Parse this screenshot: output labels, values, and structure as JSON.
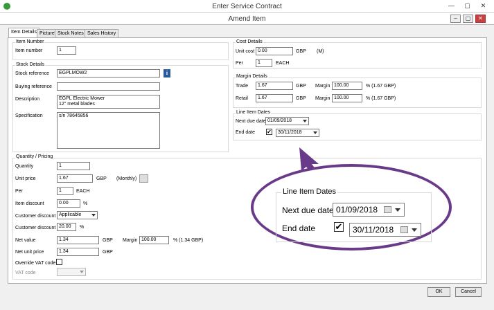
{
  "window": {
    "title": "Enter Service Contract",
    "min": "—",
    "max": "▢",
    "close": "✕"
  },
  "dialog": {
    "title": "Amend Item",
    "min": "–",
    "max": "▢",
    "close": "✕"
  },
  "tabs": [
    {
      "label": "Item Details"
    },
    {
      "label": "Picture"
    },
    {
      "label": "Stock Notes"
    },
    {
      "label": "Sales History"
    }
  ],
  "item_number": {
    "group_title": "Item Number",
    "label": "Item number",
    "value": "1"
  },
  "stock_details": {
    "group_title": "Stock Details",
    "stock_reference_label": "Stock reference",
    "stock_reference_value": "EGPLMOW2",
    "buying_reference_label": "Buying reference",
    "buying_reference_value": "",
    "description_label": "Description",
    "description_line1": "EGPL Electric Mower",
    "description_line2": "12\" metal blades",
    "specification_label": "Specification",
    "specification_value": "s/n 78645856"
  },
  "cost_details": {
    "group_title": "Cost Details",
    "unit_cost_label": "Unit cost",
    "unit_cost_value": "0.00",
    "currency": "GBP",
    "m_tag": "(M)",
    "per_label": "Per",
    "per_value": "1",
    "per_unit": "EACH"
  },
  "margin_details": {
    "group_title": "Margin Details",
    "trade_label": "Trade",
    "trade_value": "1.67",
    "retail_label": "Retail",
    "retail_value": "1.67",
    "currency": "GBP",
    "margin_label": "Margin",
    "trade_margin_value": "100.00",
    "trade_margin_note": "% (1.67 GBP)",
    "retail_margin_value": "100.00",
    "retail_margin_note": "% (1.67 GBP)"
  },
  "line_item_dates": {
    "group_title": "Line Item Dates",
    "next_due_label": "Next due date",
    "next_due_value": "01/09/2018",
    "end_date_label": "End date",
    "end_date_checked": "✔",
    "end_date_value": "30/11/2018"
  },
  "quantity_pricing": {
    "group_title": "Quantity / Pricing",
    "quantity_label": "Quantity",
    "quantity_value": "1",
    "unit_price_label": "Unit price",
    "unit_price_value": "1.67",
    "currency": "GBP",
    "monthly": "(Monthly)",
    "per_label": "Per",
    "per_value": "1",
    "per_unit": "EACH",
    "item_discount_label": "Item discount",
    "item_discount_value": "0.00",
    "percent": "%",
    "customer_discount_label": "Customer discount",
    "customer_discount_value": "Applicable",
    "customer_discount_pct_label": "Customer discount",
    "customer_discount_pct_value": "20.00",
    "net_value_label": "Net value",
    "net_value_value": "1.34",
    "margin_label": "Margin",
    "margin_value": "100.00",
    "margin_note": "% (1.34 GBP)",
    "net_unit_price_label": "Net unit price",
    "net_unit_price_value": "1.34",
    "override_vat_label": "Override VAT code",
    "vat_code_label": "VAT code",
    "vat_code_value": ""
  },
  "footer": {
    "ok": "OK",
    "cancel": "Cancel"
  },
  "colors": {
    "callout": "#6a3a8a",
    "info_icon": "#2a5a9a"
  }
}
